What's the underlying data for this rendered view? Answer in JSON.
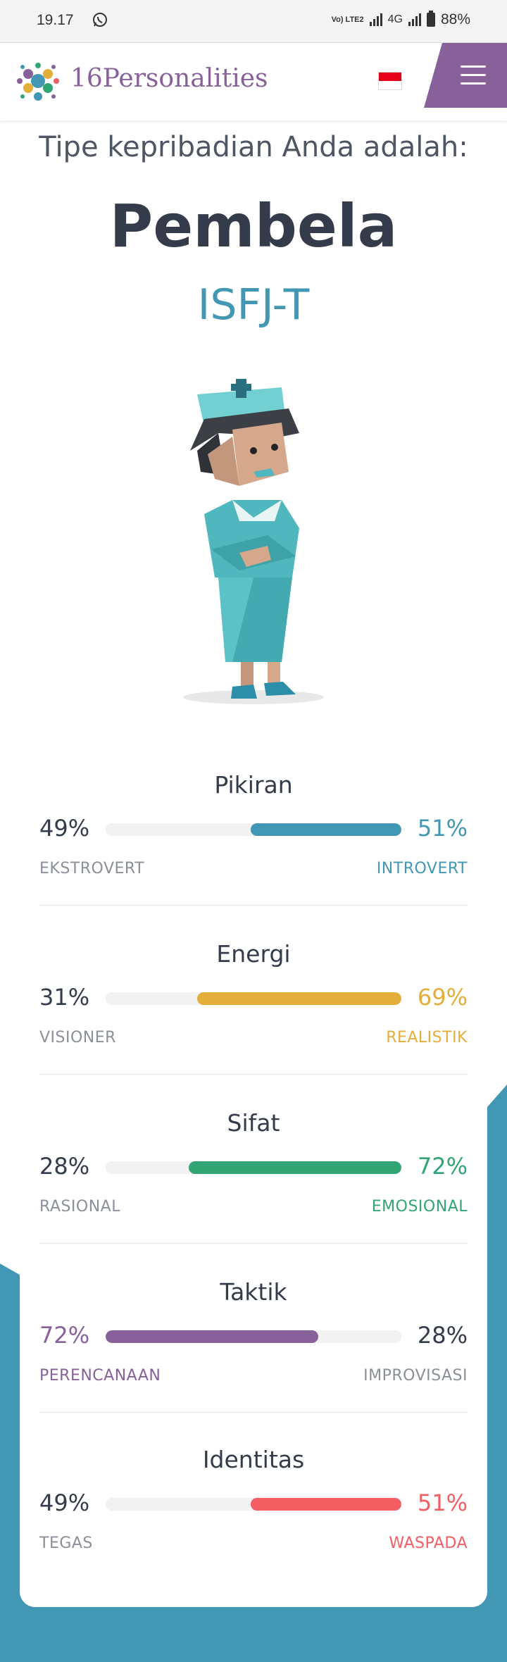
{
  "status": {
    "time": "19.17",
    "net_tag": "Vo) LTE2",
    "net_type": "4G",
    "battery": "88%"
  },
  "header": {
    "brand": "16Personalities",
    "brand_number": "16",
    "brand_word": "Personalities"
  },
  "hero": {
    "subtitle": "Tipe kepribadian Anda adalah:",
    "type_name": "Pembela",
    "type_code": "ISFJ-T"
  },
  "colors": {
    "blue": "#4298b4",
    "yellow": "#e4ae3a",
    "green": "#33a474",
    "purple": "#88619a",
    "red": "#f25e62",
    "track": "#f2f2f2"
  },
  "traits": [
    {
      "title": "Pikiran",
      "left_pct": "49%",
      "right_pct": "51%",
      "left_label": "EKSTROVERT",
      "right_label": "INTROVERT",
      "dominant": "right",
      "value": 0.51,
      "color": "#4298b4"
    },
    {
      "title": "Energi",
      "left_pct": "31%",
      "right_pct": "69%",
      "left_label": "VISIONER",
      "right_label": "REALISTIK",
      "dominant": "right",
      "value": 0.69,
      "color": "#e4ae3a"
    },
    {
      "title": "Sifat",
      "left_pct": "28%",
      "right_pct": "72%",
      "left_label": "RASIONAL",
      "right_label": "EMOSIONAL",
      "dominant": "right",
      "value": 0.72,
      "color": "#33a474"
    },
    {
      "title": "Taktik",
      "left_pct": "72%",
      "right_pct": "28%",
      "left_label": "PERENCANAAN",
      "right_label": "IMPROVISASI",
      "dominant": "left",
      "value": 0.72,
      "color": "#88619a"
    },
    {
      "title": "Identitas",
      "left_pct": "49%",
      "right_pct": "51%",
      "left_label": "TEGAS",
      "right_label": "WASPADA",
      "dominant": "right",
      "value": 0.51,
      "color": "#f25e62"
    }
  ]
}
